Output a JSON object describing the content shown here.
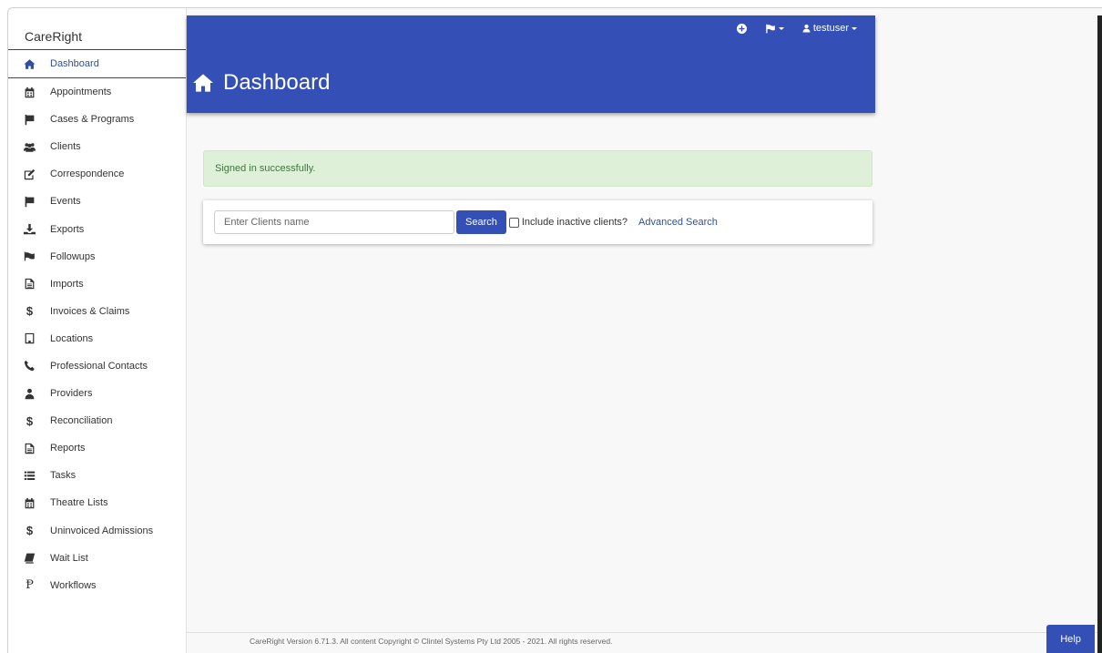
{
  "app": {
    "brand": "CareRight"
  },
  "sidebar": {
    "items": [
      {
        "label": "Dashboard",
        "icon": "home-icon",
        "active": true
      },
      {
        "label": "Appointments",
        "icon": "calendar-icon"
      },
      {
        "label": "Cases & Programs",
        "icon": "flag-icon"
      },
      {
        "label": "Clients",
        "icon": "users-icon"
      },
      {
        "label": "Correspondence",
        "icon": "edit-icon"
      },
      {
        "label": "Events",
        "icon": "flag-icon"
      },
      {
        "label": "Exports",
        "icon": "download-icon"
      },
      {
        "label": "Followups",
        "icon": "flag-checkered-icon"
      },
      {
        "label": "Imports",
        "icon": "file-text-icon"
      },
      {
        "label": "Invoices & Claims",
        "icon": "dollar-icon"
      },
      {
        "label": "Locations",
        "icon": "building-icon"
      },
      {
        "label": "Professional Contacts",
        "icon": "phone-icon"
      },
      {
        "label": "Providers",
        "icon": "user-md-icon"
      },
      {
        "label": "Reconciliation",
        "icon": "dollar-icon"
      },
      {
        "label": "Reports",
        "icon": "file-text-icon"
      },
      {
        "label": "Tasks",
        "icon": "list-icon"
      },
      {
        "label": "Theatre Lists",
        "icon": "calendar-icon"
      },
      {
        "label": "Uninvoiced Admissions",
        "icon": "dollar-icon"
      },
      {
        "label": "Wait List",
        "icon": "book-icon"
      },
      {
        "label": "Workflows",
        "icon": "workflow-p-icon"
      }
    ]
  },
  "topbar": {
    "add_icon": "plus-circle-icon",
    "flag_icon": "flag-icon",
    "user_icon": "user-icon",
    "user_label": "testuser"
  },
  "header": {
    "title": "Dashboard",
    "title_icon": "home-icon"
  },
  "alert": {
    "message": "Signed in successfully."
  },
  "search": {
    "placeholder": "Enter Clients name",
    "value": "",
    "button_label": "Search",
    "include_inactive_label": "Include inactive clients?",
    "include_inactive_checked": false,
    "advanced_link": "Advanced Search"
  },
  "footer": {
    "text": "CareRight Version 6.71.3. All content Copyright © Clintel Systems Pty Ltd 2005 - 2021. All rights reserved."
  },
  "help": {
    "label": "Help"
  },
  "colors": {
    "primary": "#344fb5",
    "link": "#2f4fa0",
    "alert_bg": "#dff0d8",
    "alert_text": "#3c763d"
  }
}
